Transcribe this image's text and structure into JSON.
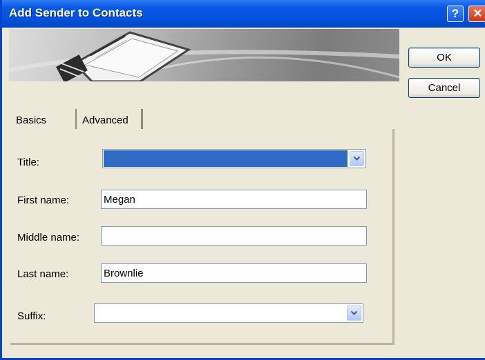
{
  "window": {
    "title": "Add Sender to Contacts"
  },
  "titlebar": {
    "help_glyph": "?",
    "close_glyph": "✕"
  },
  "buttons": {
    "ok": "OK",
    "cancel": "Cancel"
  },
  "tabs": [
    {
      "label": "Basics",
      "selected": true
    },
    {
      "label": "Advanced",
      "selected": false
    }
  ],
  "form": {
    "title_label": "Title:",
    "title_value": "",
    "first_name_label": "First name:",
    "first_name_value": "Megan",
    "middle_name_label": "Middle name:",
    "middle_name_value": "",
    "last_name_label": "Last name:",
    "last_name_value": "Brownlie",
    "suffix_label": "Suffix:",
    "suffix_value": ""
  },
  "colors": {
    "titlebar": "#0553e1",
    "selection": "#316ac5",
    "dialog_bg": "#ece9d8"
  }
}
